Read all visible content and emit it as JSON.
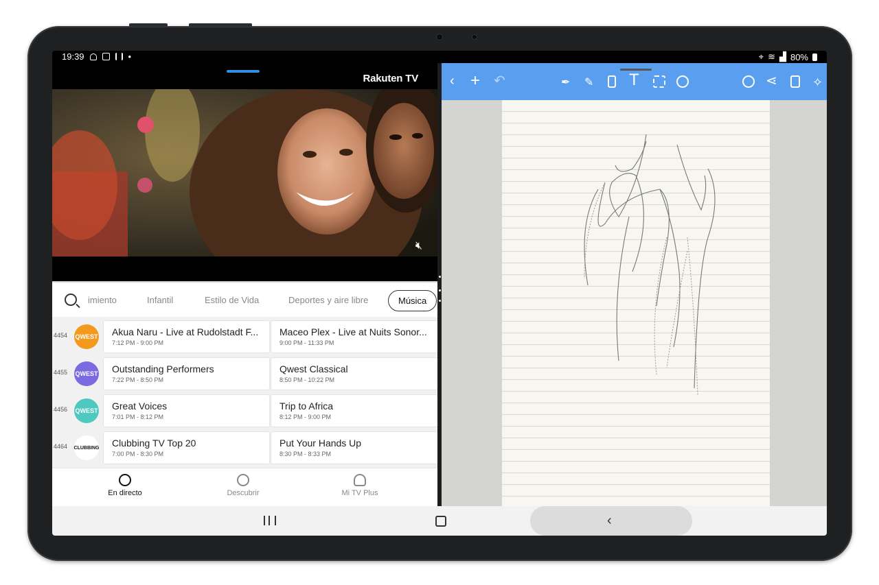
{
  "status": {
    "time": "19:39",
    "battery": "80%"
  },
  "player": {
    "brand": "Rakuten TV"
  },
  "categories": {
    "items": [
      "imiento",
      "Infantil",
      "Estilo de Vida",
      "Deportes y aire libre"
    ],
    "active": "Música"
  },
  "guide": {
    "rows": [
      {
        "channel": "4454",
        "logo": "QWEST",
        "color": "#f39a1e",
        "p1": {
          "title": "Akua Naru - Live at Rudolstadt F...",
          "time": "7:12 PM - 9:00 PM"
        },
        "p2": {
          "title": "Maceo Plex - Live at Nuits Sonor...",
          "time": "9:00 PM - 11:33 PM"
        }
      },
      {
        "channel": "4455",
        "logo": "QWEST",
        "color": "#7c6be0",
        "p1": {
          "title": "Outstanding Performers",
          "time": "7:22 PM - 8:50 PM"
        },
        "p2": {
          "title": "Qwest Classical",
          "time": "8:50 PM - 10:22 PM"
        }
      },
      {
        "channel": "4456",
        "logo": "QWEST",
        "color": "#4fc9c0",
        "p1": {
          "title": "Great Voices",
          "time": "7:01 PM - 8:12 PM"
        },
        "p2": {
          "title": "Trip to Africa",
          "time": "8:12 PM - 9:00 PM"
        }
      },
      {
        "channel": "4464",
        "logo": "CLUBBING",
        "color": "#ffffff",
        "p1": {
          "title": "Clubbing TV Top 20",
          "time": "7:00 PM - 8:30 PM"
        },
        "p2": {
          "title": "Put Your Hands Up",
          "time": "8:30 PM - 8:33 PM"
        }
      }
    ]
  },
  "bottomnav": {
    "live": "En directo",
    "discover": "Descubrir",
    "mytv": "Mi TV Plus"
  },
  "colors": {
    "toolbar": "#5a9fef",
    "accent": "#2f8fe0"
  }
}
